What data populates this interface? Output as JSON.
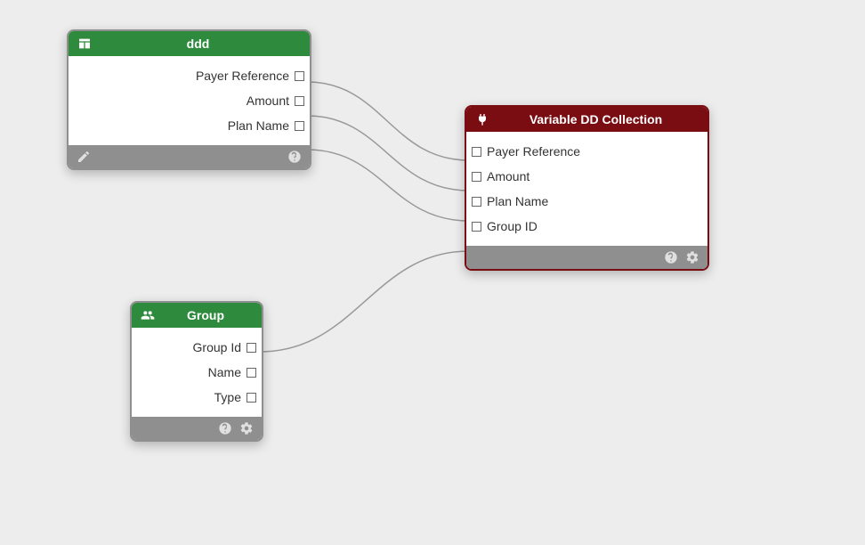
{
  "nodes": {
    "ddd": {
      "title": "ddd",
      "icon": "table",
      "color": "green",
      "fields": [
        "Payer Reference",
        "Amount",
        "Plan Name"
      ]
    },
    "group": {
      "title": "Group",
      "icon": "users",
      "color": "green",
      "fields": [
        "Group Id",
        "Name",
        "Type"
      ]
    },
    "vdd": {
      "title": "Variable DD Collection",
      "icon": "plug",
      "color": "maroon",
      "fields": [
        "Payer Reference",
        "Amount",
        "Plan Name",
        "Group ID"
      ]
    }
  }
}
